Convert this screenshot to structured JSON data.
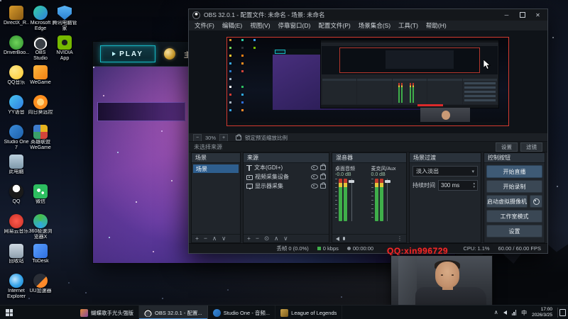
{
  "desktop": {
    "icons": [
      {
        "label": "DirectX_R..."
      },
      {
        "label": "DriverBoo..."
      },
      {
        "label": "QQ音乐"
      },
      {
        "label": "YY语音"
      },
      {
        "label": "Studio One 7"
      },
      {
        "label": "此电脑"
      },
      {
        "label": "QQ"
      },
      {
        "label": "网易云音乐"
      },
      {
        "label": "回收站"
      },
      {
        "label": "Internet Explorer"
      },
      {
        "label": "Microsoft Edge"
      },
      {
        "label": "OBS Studio"
      },
      {
        "label": "WeGame"
      },
      {
        "label": "向日葵远控"
      },
      {
        "label": "英雄联盟WeGame"
      },
      {
        "label": "微信"
      },
      {
        "label": "360极速浏览器X"
      },
      {
        "label": "ToDesk"
      },
      {
        "label": "UU加速器"
      },
      {
        "label": "腾讯电脑管家"
      },
      {
        "label": "NVIDIA App"
      }
    ],
    "watermark": "QQ:xin996729"
  },
  "league": {
    "play_label": "PLAY",
    "home_tab": "主页"
  },
  "obs": {
    "window_title": "OBS 32.0.1 - 配置文件: 未命名 - 场景: 未命名",
    "menu": [
      "文件(F)",
      "编辑(E)",
      "视图(V)",
      "停靠窗口(D)",
      "配置文件(P)",
      "场景集合(S)",
      "工具(T)",
      "帮助(H)"
    ],
    "preview": {
      "zoom": "30%",
      "zoom_lock_label": "锁定预览缩放比例"
    },
    "source_toolbar": {
      "no_source": "未选择来源",
      "properties_btn": "设置",
      "filters_btn": "滤镜"
    },
    "scenes_panel": {
      "title": "场景",
      "scene": "场景"
    },
    "sources_panel": {
      "title": "来源",
      "rows": [
        "文本(GDI+)",
        "视频采集设备",
        "显示器采集"
      ]
    },
    "mixer_panel": {
      "title": "混音器",
      "ch1_name": "桌面音频",
      "ch1_db": "-0.0 dB",
      "ch2_name": "麦克风/Aux",
      "ch2_db": "0.0 dB"
    },
    "transition_panel": {
      "title": "场景过渡",
      "selected": "淡入淡出",
      "duration_label": "持续时间",
      "duration_value": "300 ms"
    },
    "controls_panel": {
      "title": "控制按钮",
      "buttons": [
        "开始直播",
        "开始录制",
        "启动虚拟摄像机",
        "工作室模式",
        "设置"
      ]
    },
    "status_bar": {
      "dropped": "丢帧 0 (0.0%)",
      "bitrate": "0 kbps",
      "rec_time": "00:00:00",
      "cpu": "CPU: 1.1%",
      "fps": "60.00 / 60.00 FPS"
    }
  },
  "taskbar": {
    "apps": [
      {
        "title": "蝴蝶歌手光头强版"
      },
      {
        "title": "OBS 32.0.1 - 配置..."
      },
      {
        "title": "Studio One - 音频..."
      },
      {
        "title": "League of Legends"
      }
    ],
    "tray": {
      "ime": "中",
      "time": "17:00",
      "date": "2026/3/25"
    }
  }
}
